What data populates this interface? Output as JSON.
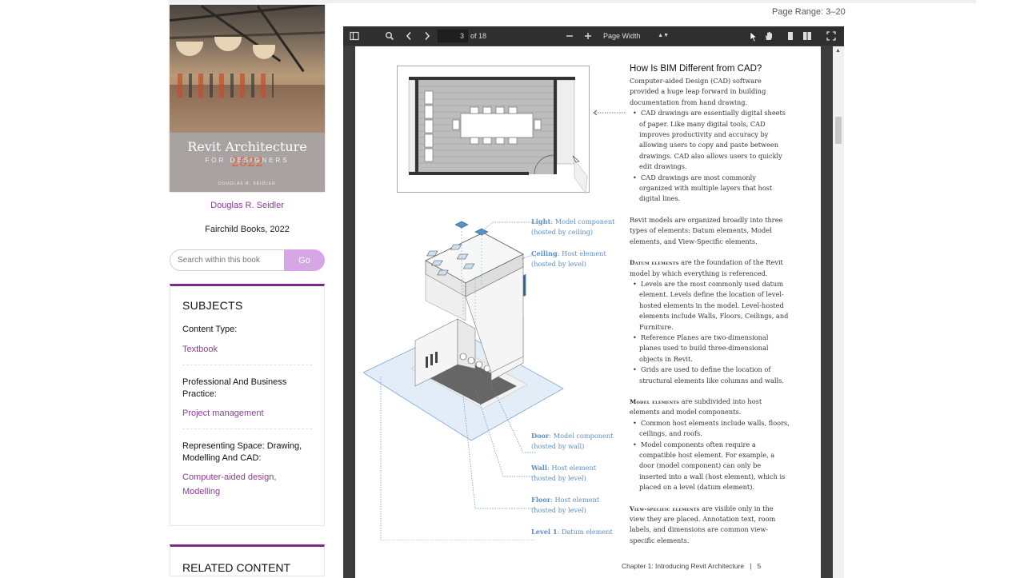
{
  "book": {
    "cover_title": "Revit Architecture",
    "cover_year": "2022",
    "cover_subtitle": "FOR DESIGNERS",
    "cover_author": "DOUGLAS R. SEIDLER",
    "author": "Douglas R. Seidler",
    "publisher": "Fairchild Books, 2022"
  },
  "search": {
    "placeholder": "Search within this book",
    "button": "Go"
  },
  "subjects": {
    "heading": "SUBJECTS",
    "groups": [
      {
        "label": "Content Type:",
        "links": [
          "Textbook"
        ]
      },
      {
        "label": "Professional And Business Practice:",
        "links": [
          "Project management"
        ]
      },
      {
        "label": "Representing Space: Drawing, Modelling And CAD:",
        "links": [
          "Computer-aided design,",
          "Modelling"
        ]
      }
    ]
  },
  "related": {
    "heading": "RELATED CONTENT"
  },
  "page_range": "Page Range: 3–20",
  "viewer": {
    "current_page": "3",
    "total_pages": "of 18",
    "zoom": "Page Width",
    "icons": [
      "sidebar-icon",
      "search-icon",
      "prev-page-icon",
      "next-page-icon",
      "zoom-out-icon",
      "zoom-in-icon",
      "caret-icon",
      "select-cursor-icon",
      "hand-tool-icon",
      "single-page-icon",
      "two-page-icon",
      "fullscreen-icon"
    ]
  },
  "pdf_page": {
    "title": "How Is BIM Different from CAD?",
    "intro": "Computer-aided Design (CAD) software provided a huge leap forward in building documentation from hand drawing.",
    "cad_bullets": [
      "CAD drawings are essentially digital sheets of paper. Like many digital tools, CAD improves productivity and accuracy by allowing users to copy and paste between drawings. CAD also allows users to quickly edit drawings.",
      "CAD drawings are most commonly organized with multiple layers that host digital lines."
    ],
    "revit_intro": "Revit models are organized broadly into three types of elements: Datum elements, Model elements, and View-Specific elements.",
    "datum_head": "Datum elements",
    "datum_text": " are the foundation of the Revit model by which everything is referenced.",
    "datum_bullets": [
      "Levels are the most commonly used datum element. Levels define the location of level-hosted elements in the model. Level-hosted elements include Walls, Floors, Ceilings, and Furniture.",
      "Reference Planes are two-dimensional planes used to build three-dimensional objects in Revit.",
      "Grids are used to define the location of structural elements like columns and walls."
    ],
    "model_head": "Model elements",
    "model_text": " are subdivided into host elements and model components.",
    "model_bullets": [
      "Common host elements include walls, floors, ceilings, and roofs.",
      "Model components often require a compatible host element. For example, a door (model component) can only be inserted into a wall (host element), which is placed on a level (datum element)."
    ],
    "view_head": "View-specific elements",
    "view_text": " are visible only in the view they are placed. Annotation text, room labels, and dimensions are common view-specific elements.",
    "callouts": [
      {
        "key": "Light",
        "rest": ": Model component",
        "sub": "(hosted by ceiling)"
      },
      {
        "key": "Ceiling",
        "rest": ": Host element",
        "sub": "(hosted by level)"
      },
      {
        "key": "Door",
        "rest": ": Model component",
        "sub": "(hosted by wall)"
      },
      {
        "key": "Wall",
        "rest": ": Host element",
        "sub": "(hosted by level)"
      },
      {
        "key": "Floor",
        "rest": ": Host element",
        "sub": "(hosted by level)"
      },
      {
        "key": "Level 1",
        "rest": ": Datum element",
        "sub": ""
      }
    ],
    "footer_chapter": "Chapter 1: Introducing Revit Architecture",
    "footer_sep": "|",
    "footer_page": "5"
  }
}
